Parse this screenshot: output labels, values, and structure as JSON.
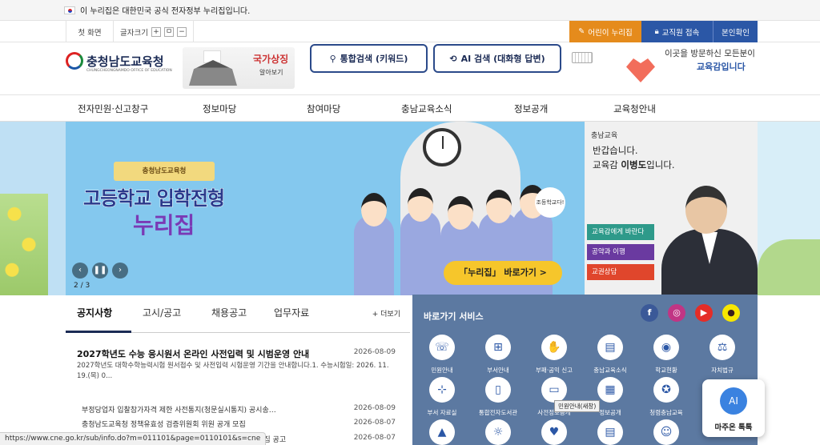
{
  "gov_banner": {
    "text": "이 누리집은 대한민국 공식 전자정부 누리집입니다."
  },
  "util": {
    "home": "첫 화면",
    "font_size_label": "글자크기",
    "font_plus": "+",
    "font_reset": "ㅁ",
    "font_minus": "−",
    "kids_site": "어린이 누리집",
    "staff_login": "교직원 접속",
    "auth": "본인확인"
  },
  "header": {
    "logo_text": "충청남도교육청",
    "logo_sub": "CHUNGCHEONGNAMDO OFFICE OF EDUCATION",
    "national_symbol_title": "국가상징",
    "national_symbol_sub": "알아보기",
    "search_keyword": "통합검색 (키워드)",
    "search_ai": "AI 검색 (대화형 답변)",
    "visit_line1": "이곳을 방문하신 모든분이",
    "visit_line2": "교육감입니다"
  },
  "nav": {
    "items": [
      "전자민원·신고창구",
      "정보마당",
      "참여마당",
      "충남교육소식",
      "정보공개",
      "교육청안내"
    ]
  },
  "banner": {
    "ribbon": "충청남도교육청",
    "title1": "고등학교 입학전형",
    "title2": "누리집",
    "bubble": "조등학교다!",
    "cta": "「누리집」 바로가기  >",
    "pager": "2 / 3"
  },
  "welcome": {
    "logo": "충남교육",
    "line1": "반갑습니다.",
    "line2_pre": "교육감 ",
    "line2_name": "이병도",
    "line2_post": "입니다.",
    "buttons": [
      "교육감에게 바란다",
      "공약과 이행",
      "교권상담"
    ]
  },
  "notices": {
    "tabs": [
      "공지사항",
      "고시/공고",
      "채용공고",
      "업무자료"
    ],
    "more": "+ 더보기",
    "featured": {
      "title": "2027학년도 수능 응시원서 온라인 사전입력 및 시범운영 안내",
      "date": "2026-08-09",
      "body": "2027학년도 대학수학능력시험 원서접수 및 사전입력 시험운영 기간을 안내합니다.1. 수능시험일: 2026. 11. 19.(목) 0..."
    },
    "rows": [
      {
        "title": "부정당업자 입찰참가자격 제한 사전통지(청문실시통지) 공시송…",
        "date": "2026-08-09"
      },
      {
        "title": "충청남도교육청 정책유효성 검증위원회 위원 공개 모집",
        "date": "2026-08-07"
      },
      {
        "title": "원 모집 공고",
        "date": "2026-08-07"
      }
    ]
  },
  "services": {
    "title": "바로가기 서비스",
    "sns": [
      "f",
      "◎",
      "▶",
      "●"
    ],
    "items": [
      "민원안내",
      "부서안내",
      "부패·공익 신고",
      "충남교육소식",
      "학교현황",
      "자치법규",
      "부서 자료실",
      "통합전자도서관",
      "사전정보공개",
      "정보공개",
      "청렴충남교육",
      ""
    ]
  },
  "tooltip": "민원안내(새창)",
  "chat": {
    "label": "마주온 톡톡",
    "icon": "AI"
  },
  "status_url": "https://www.cne.go.kr/sub/info.do?m=011101&page=0110101&s=cne",
  "colors": {
    "navy": "#1b2b55",
    "blue": "#2b57a6",
    "orange": "#e58b1c",
    "services_bg": "#5c79a1"
  }
}
